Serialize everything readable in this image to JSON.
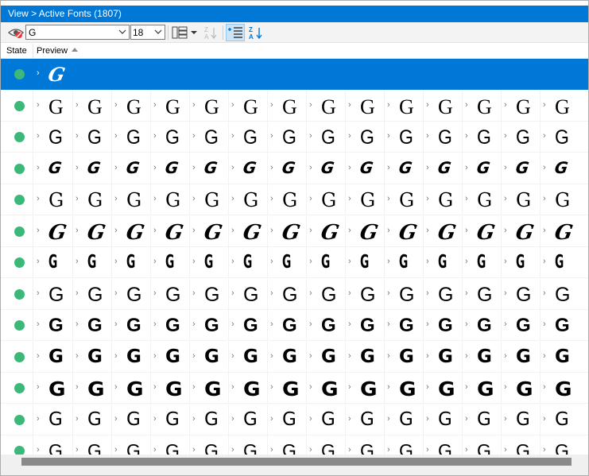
{
  "breadcrumb": {
    "text": "View > Active Fonts (1807)"
  },
  "toolbar": {
    "preview_text": "G",
    "font_size": "18",
    "icons": [
      "hide-preview-eye-icon",
      "dropdown-arrow-icon",
      "layout-columns-icon",
      "sort-az-icon",
      "list-indent-icon"
    ]
  },
  "columns": {
    "state": "State",
    "preview": "Preview"
  },
  "colors": {
    "accent": "#0078d7",
    "active_dot": "#3cb878",
    "chevron": "#777777"
  },
  "rows": [
    {
      "glyph": "G",
      "selected": true,
      "style": "script-brush",
      "cells": 1
    },
    {
      "glyph": "G",
      "selected": false,
      "style": "serif",
      "cells": 14
    },
    {
      "glyph": "G",
      "selected": false,
      "style": "sans-light",
      "cells": 14
    },
    {
      "glyph": "G",
      "selected": false,
      "style": "brush",
      "cells": 14
    },
    {
      "glyph": "G",
      "selected": false,
      "style": "serif-light",
      "cells": 14
    },
    {
      "glyph": "G",
      "selected": false,
      "style": "script-bold",
      "cells": 14
    },
    {
      "glyph": "G",
      "selected": false,
      "style": "condensed",
      "cells": 14
    },
    {
      "glyph": "G",
      "selected": false,
      "style": "sans-thin",
      "cells": 14
    },
    {
      "glyph": "G",
      "selected": false,
      "style": "sans-bold",
      "cells": 14
    },
    {
      "glyph": "G",
      "selected": false,
      "style": "sans-semibold",
      "cells": 14
    },
    {
      "glyph": "G",
      "selected": false,
      "style": "sans-black",
      "cells": 14
    },
    {
      "glyph": "G",
      "selected": false,
      "style": "sans-medium",
      "cells": 14
    },
    {
      "glyph": "G",
      "selected": false,
      "style": "sans-regular",
      "cells": 14
    }
  ]
}
